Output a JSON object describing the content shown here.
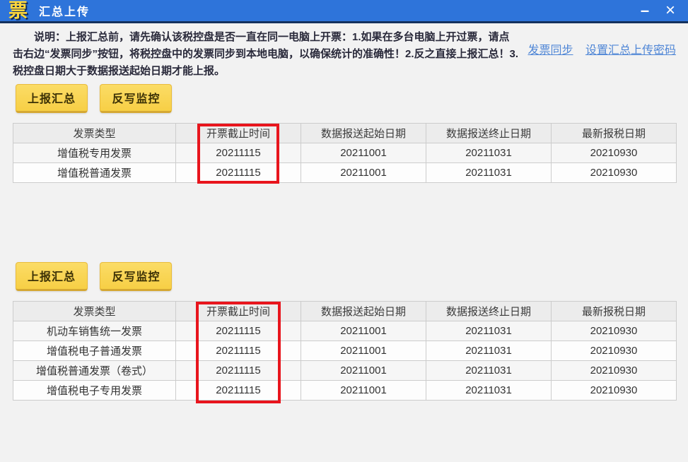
{
  "window": {
    "logo_glyph": "票",
    "title": "汇总上传",
    "minimize_glyph": "–",
    "close_glyph": "×"
  },
  "description": {
    "text": "说明：上报汇总前，请先确认该税控盘是否一直在同一电脑上开票：1.如果在多台电脑上开过票，请点击右边“发票同步”按钮，将税控盘中的发票同步到本地电脑，以确保统计的准确性！2.反之直接上报汇总！3.税控盘日期大于数据报送起始日期才能上报。"
  },
  "links": {
    "invoice_sync": "发票同步",
    "set_upload_password": "设置汇总上传密码"
  },
  "actions": {
    "report_summary": "上报汇总",
    "writeback_monitor": "反写监控"
  },
  "tables": {
    "headers": [
      "发票类型",
      "开票截止时间",
      "数据报送起始日期",
      "数据报送终止日期",
      "最新报税日期"
    ],
    "table1_rows": [
      [
        "增值税专用发票",
        "20211115",
        "20211001",
        "20211031",
        "20210930"
      ],
      [
        "增值税普通发票",
        "20211115",
        "20211001",
        "20211031",
        "20210930"
      ]
    ],
    "table2_rows": [
      [
        "机动车销售统一发票",
        "20211115",
        "20211001",
        "20211031",
        "20210930"
      ],
      [
        "增值税电子普通发票",
        "20211115",
        "20211001",
        "20211031",
        "20210930"
      ],
      [
        "增值税普通发票（卷式）",
        "20211115",
        "20211001",
        "20211031",
        "20210930"
      ],
      [
        "增值税电子专用发票",
        "20211115",
        "20211001",
        "20211031",
        "20210930"
      ]
    ]
  },
  "colors": {
    "titlebar_blue": "#2e74da",
    "button_yellow": "#f7cf45",
    "highlight_red": "#e8151d",
    "link_blue": "#4f86d6",
    "logo_yellow": "#ffd83c"
  }
}
